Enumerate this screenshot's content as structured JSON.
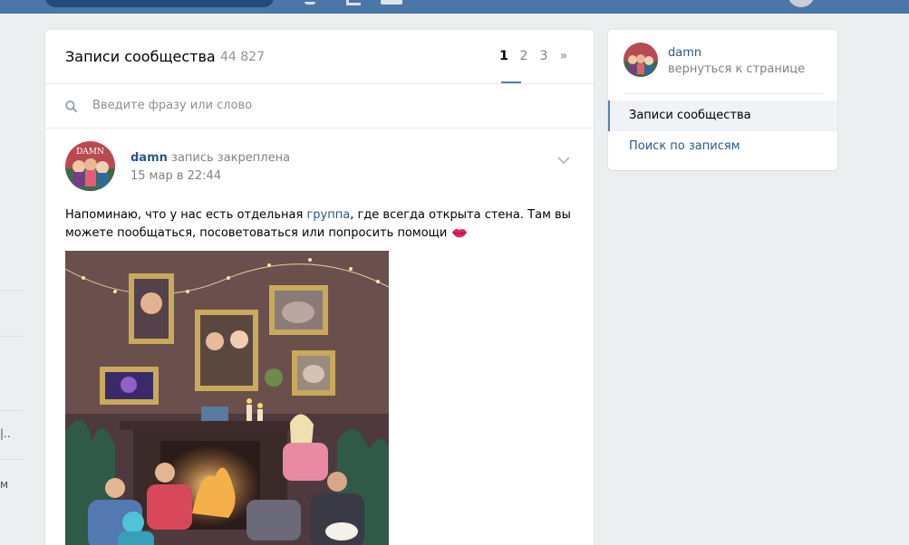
{
  "header": {
    "title": "Записи сообщества",
    "count": "44 827"
  },
  "pagination": {
    "pages": [
      "1",
      "2",
      "3"
    ],
    "next": "»",
    "current": "1"
  },
  "search": {
    "placeholder": "Введите фразу или слово"
  },
  "post": {
    "author": "damn",
    "pinned_note": "запись закреплена",
    "date": "15 мар в 22:44",
    "text_before_link": "Напоминаю, что у нас есть отдельная ",
    "link_text": "группа",
    "text_after_link": ", где всегда открыта стена. Там вы можете пообщаться, посоветоваться или попросить помощи",
    "avatar_label": "DAMN"
  },
  "sidebar": {
    "group_name": "damn",
    "back_label": "вернуться к странице",
    "items": [
      {
        "label": "Записи сообщества"
      },
      {
        "label": "Поиск по записям"
      }
    ]
  },
  "left_menu": {
    "truncated": [
      "|..",
      "м"
    ]
  },
  "colors": {
    "topbar": "#4a76a8",
    "link": "#2a5885",
    "accent": "#5181b8",
    "background": "#edeef0"
  }
}
